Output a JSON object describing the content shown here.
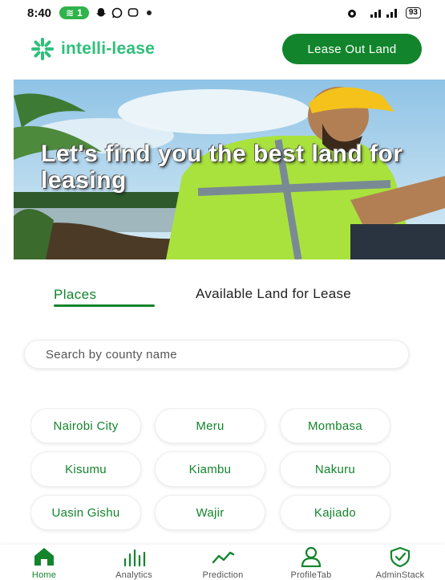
{
  "status_bar": {
    "time": "8:40",
    "sim_badge": "1",
    "battery": "93"
  },
  "header": {
    "app_name": "intelli-lease",
    "lease_out_button": "Lease Out Land"
  },
  "hero": {
    "title": "Let's find you the best land for leasing"
  },
  "tabs": {
    "places": "Places",
    "available": "Available Land for Lease",
    "active": "places"
  },
  "search": {
    "placeholder": "Search by county name",
    "value": ""
  },
  "counties": [
    "Nairobi City",
    "Meru",
    "Mombasa",
    "Kisumu",
    "Kiambu",
    "Nakuru",
    "Uasin Gishu",
    "Wajir",
    "Kajiado"
  ],
  "bottom_nav": [
    {
      "label": "Home",
      "icon": "home-icon",
      "active": true
    },
    {
      "label": "Analytics",
      "icon": "bar-chart-icon",
      "active": false
    },
    {
      "label": "Prediction",
      "icon": "trend-line-icon",
      "active": false
    },
    {
      "label": "ProfileTab",
      "icon": "user-icon",
      "active": false
    },
    {
      "label": "AdminStack",
      "icon": "shield-check-icon",
      "active": false
    }
  ],
  "colors": {
    "brand_green": "#12852c",
    "logo_green": "#2fbf7a"
  }
}
